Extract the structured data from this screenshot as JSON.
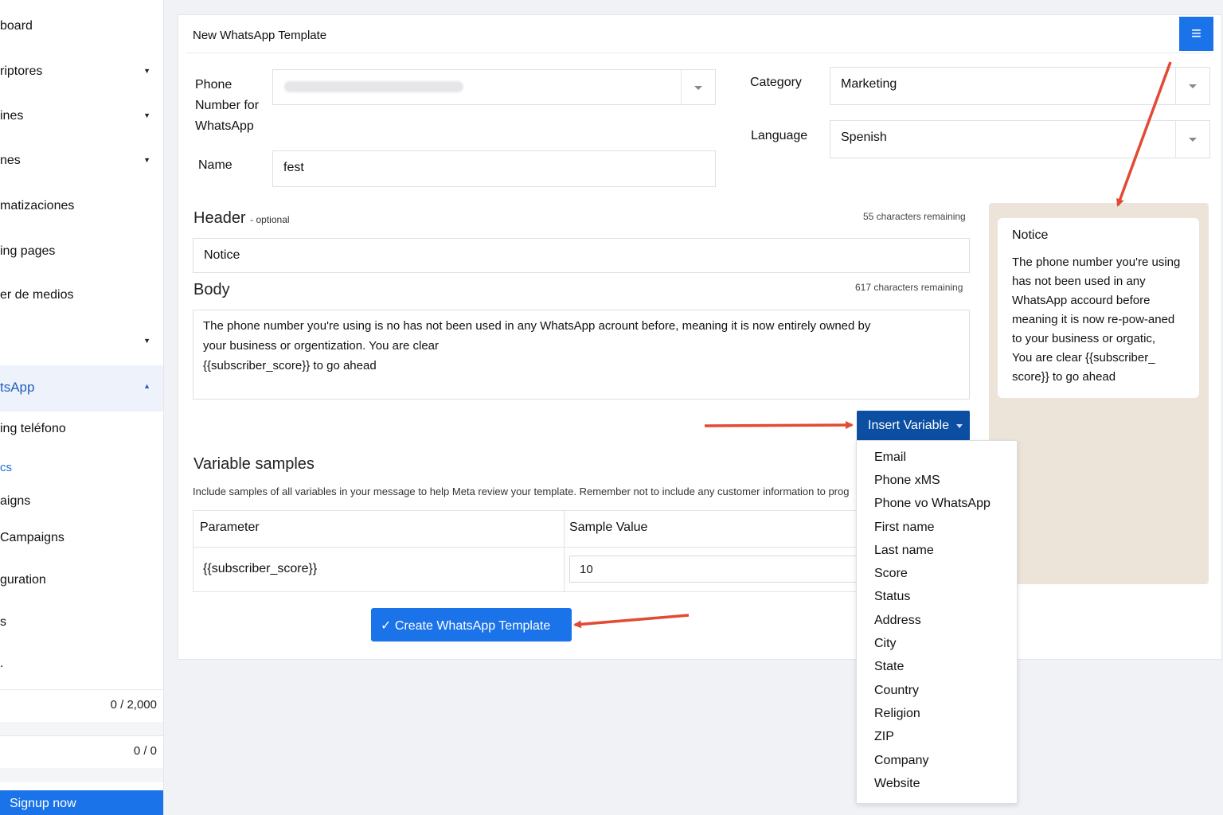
{
  "sidebar": {
    "items": [
      {
        "label": "board"
      },
      {
        "label": "riptores"
      },
      {
        "label": "ines"
      },
      {
        "label": "nes"
      },
      {
        "label": "matizaciones"
      },
      {
        "label": "ing pages"
      },
      {
        "label": "er de medios"
      },
      {
        "label": ""
      },
      {
        "label": "tsApp"
      },
      {
        "label": "ing teléfono"
      },
      {
        "label": "cs"
      },
      {
        "label": "aigns"
      },
      {
        "label": "Campaigns"
      },
      {
        "label": "guration"
      },
      {
        "label": "s"
      },
      {
        "label": "."
      }
    ],
    "stats": [
      "0 / 2,000",
      "0 / 0"
    ],
    "signup_label": "Signup now"
  },
  "form": {
    "title": "New WhatsApp Template",
    "menu_icon": "hamburger-icon",
    "phone_label_lines": [
      "Phone",
      "Number for",
      "WhatsApp"
    ],
    "name_label": "Name",
    "name_value": "fest",
    "category_label": "Category",
    "category_value": "Marketing",
    "language_label": "Language",
    "language_value": "Spenish",
    "header_title": "Header",
    "header_optional": "- optional",
    "header_remaining": "55 characters remaining",
    "header_value": "Notice",
    "body_title": "Body",
    "body_remaining": "617 characters remaining",
    "body_lines": [
      "The phone number you're using is no has not been used in any WhatsApp acrount before,  meaning it is now entirely owned by",
      "your business or orgentization.  You are clear",
      "{{subscriber_score}} to go ahead"
    ],
    "insert_variable_label": "Insert Variable",
    "variable_samples_title": "Variable samples",
    "variable_samples_hint": "Include samples of all variables in your message to help Meta review your template. Remember not to include any customer information to prog",
    "table": {
      "headers": [
        "Parameter",
        "Sample Value"
      ],
      "rows": [
        {
          "parameter": "{{subscriber_score}}",
          "sample": "10"
        }
      ]
    },
    "create_button_label": "✓ Create WhatsApp Template"
  },
  "preview": {
    "title": "Notice",
    "body_lines": [
      "The phone number you're using",
      "has not been used in any",
      "WhatsApp accourd before",
      "meaning it is now re-pow-aned",
      "to your business or orgatic,",
      "You are clear {{subscriber_",
      "score}} to go ahead"
    ]
  },
  "variable_menu": {
    "items": [
      "Email",
      "Phone xMS",
      "Phone vo WhatsApp",
      "First name",
      "Last name",
      "Score",
      "Status",
      "Address",
      "City",
      "State",
      "Country",
      "Religion",
      "ZIP",
      "Company",
      "Website"
    ]
  },
  "colors": {
    "accent": "#1a73e8",
    "insert_button": "#0b4ea2",
    "preview_bg": "#ede4d9",
    "annotation_arrow": "#e24a33"
  }
}
